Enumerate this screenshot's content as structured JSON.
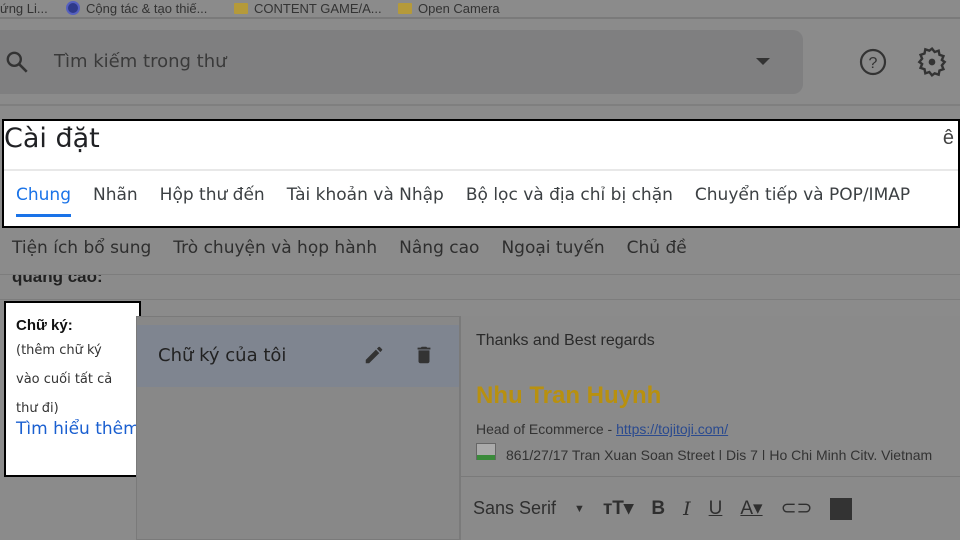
{
  "bookmarks": [
    "ứng Li...",
    "Cộng tác & tạo thiế...",
    "CONTENT GAME/A...",
    "Open Camera"
  ],
  "search": {
    "placeholder": "Tìm kiếm trong thư"
  },
  "settings": {
    "title": "Cài đặt",
    "corner_char": "ê",
    "tabs": [
      "Chung",
      "Nhãn",
      "Hộp thư đến",
      "Tài khoản và Nhập",
      "Bộ lọc và địa chỉ bị chặn",
      "Chuyển tiếp và POP/IMAP"
    ],
    "tabs2": [
      "Tiện ích bổ sung",
      "Trò chuyện và họp hành",
      "Nâng cao",
      "Ngoại tuyến",
      "Chủ đề"
    ]
  },
  "cut_text": "quảng cáo:",
  "signature": {
    "label": "Chữ ký:",
    "desc": [
      "(thêm chữ ký",
      "vào cuối tất cả",
      "thư đi)"
    ],
    "learn_more": "Tìm hiểu thêm",
    "item": "Chữ ký của tôi",
    "body": {
      "greeting": "Thanks and Best regards",
      "name": "Nhu Tran Huynh",
      "role": "Head of Ecommerce - ",
      "link": "https://tojitoji.com/",
      "address": "861/27/17 Tran Xuan Soan Street | Dis 7 | Ho Chi Minh City, Vietnam"
    },
    "font": "Sans Serif"
  },
  "colors": {
    "accent": "#1a73e8",
    "name": "#b8900f",
    "link": "#2a4a8f"
  }
}
